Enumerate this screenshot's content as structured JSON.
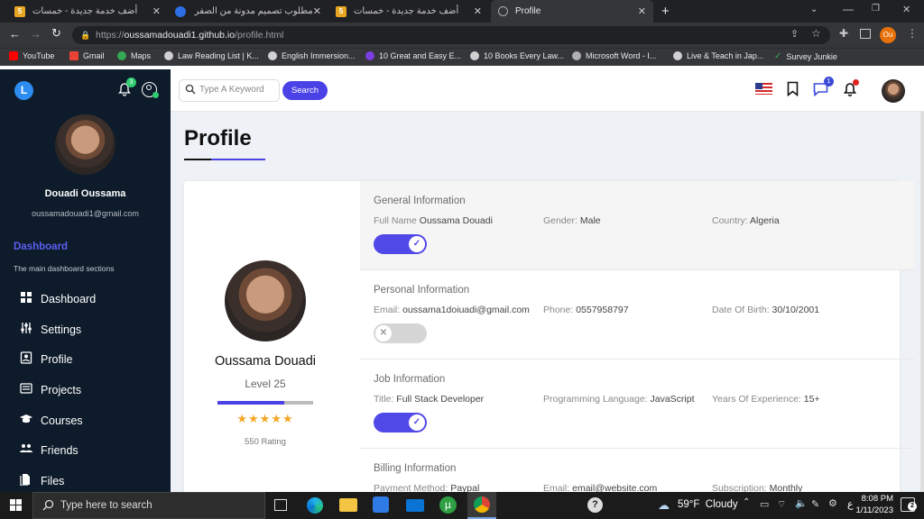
{
  "browser": {
    "tabs": [
      {
        "title": "أضف خدمة جديدة - خمسات",
        "icon": "khamsat-icon"
      },
      {
        "title": "مطلوب تصميم مدونة من الصفر | د",
        "icon": "mostaql-icon"
      },
      {
        "title": "أضف خدمة جديدة - خمسات",
        "icon": "khamsat-icon"
      },
      {
        "title": "Profile",
        "icon": "globe-icon"
      }
    ],
    "url_prefix": "https://",
    "url_host": "oussamadouadi1.github.io",
    "url_path": "/profile.html",
    "profile_badge": "Ou",
    "bookmarks": [
      "YouTube",
      "Gmail",
      "Maps",
      "Law Reading List | K...",
      "English Immersion...",
      "10 Great and Easy E...",
      "10 Books Every Law...",
      "Microsoft Word - I...",
      "Live & Teach in Jap...",
      "Survey Junkie"
    ]
  },
  "sidebar": {
    "logo": "L",
    "notif_count": "3",
    "user_name": "Douadi Oussama",
    "user_email": "oussamadouadi1@gmail.com",
    "section_title": "Dashboard",
    "section_desc": "The main dashboard sections",
    "items": [
      {
        "label": "Dashboard",
        "icon": "dashboard-icon"
      },
      {
        "label": "Settings",
        "icon": "settings-icon"
      },
      {
        "label": "Profile",
        "icon": "profile-icon"
      },
      {
        "label": "Projects",
        "icon": "projects-icon"
      },
      {
        "label": "Courses",
        "icon": "courses-icon"
      },
      {
        "label": "Friends",
        "icon": "friends-icon"
      },
      {
        "label": "Files",
        "icon": "files-icon"
      }
    ]
  },
  "topnav": {
    "search_placeholder": "Type A Keyword",
    "search_button": "Search",
    "chat_count": "1"
  },
  "page": {
    "title": "Profile",
    "card": {
      "name": "Oussama Douadi",
      "level": "Level 25",
      "level_progress": 0.7,
      "stars": 5,
      "rating": "550 Rating"
    },
    "sections": [
      {
        "title": "General Information",
        "fields": [
          {
            "label": "Full Name",
            "value": "Oussama Douadi"
          },
          {
            "label": "Gender:",
            "value": "Male"
          },
          {
            "label": "Country:",
            "value": "Algeria"
          }
        ],
        "toggle": true
      },
      {
        "title": "Personal Information",
        "fields": [
          {
            "label": "Email:",
            "value": "oussama1doiuadi@gmail.com"
          },
          {
            "label": "Phone:",
            "value": "0557958797"
          },
          {
            "label": "Date Of Birth:",
            "value": "30/10/2001"
          }
        ],
        "toggle": false
      },
      {
        "title": "Job Information",
        "fields": [
          {
            "label": "Title:",
            "value": "Full Stack Developer"
          },
          {
            "label": "Programming Language:",
            "value": "JavaScript"
          },
          {
            "label": "Years Of Experience:",
            "value": "15+"
          }
        ],
        "toggle": true
      },
      {
        "title": "Billing Information",
        "fields": [
          {
            "label": "Payment Method:",
            "value": "Paypal"
          },
          {
            "label": "Email:",
            "value": "email@website.com"
          },
          {
            "label": "Subscription:",
            "value": "Monthly"
          }
        ]
      }
    ]
  },
  "taskbar": {
    "search_placeholder": "Type here to search",
    "weather": "59°F  Cloudy",
    "lang": "ع",
    "time": "8:08 PM",
    "date": "1/11/2023"
  },
  "colors": {
    "accent": "#5148e8",
    "sidebar_bg": "#0d1b2a",
    "star": "#f5a623"
  }
}
